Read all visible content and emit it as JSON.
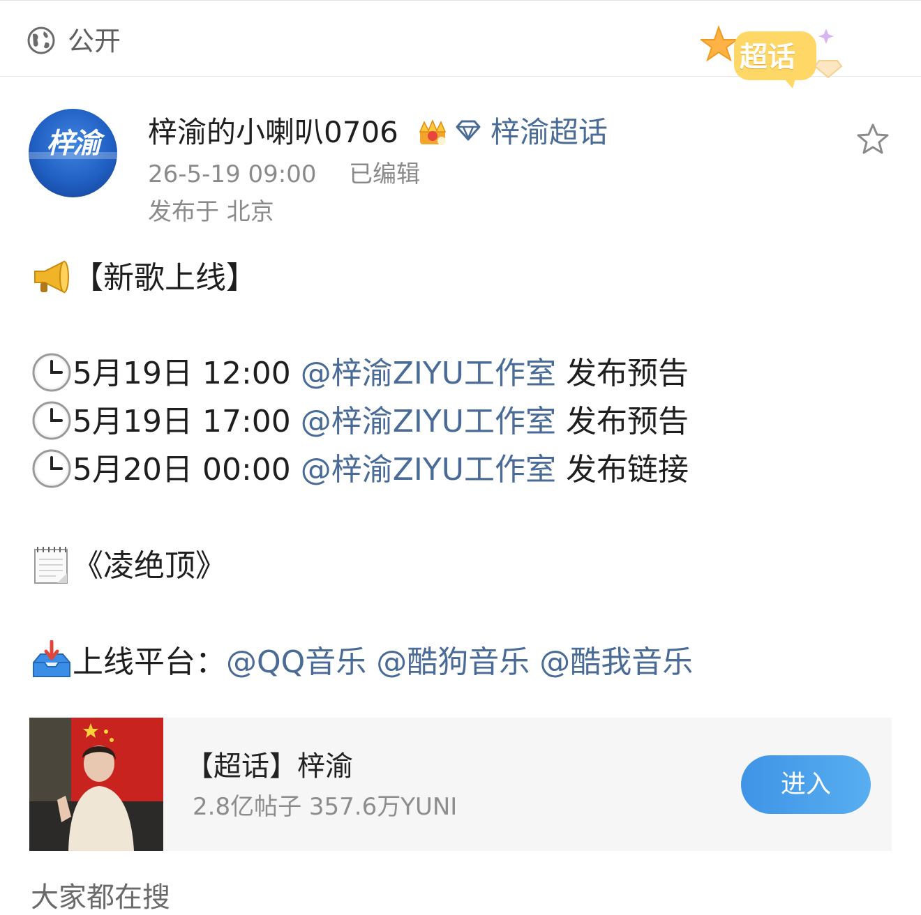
{
  "visibility": {
    "icon": "globe-icon",
    "label": "公开"
  },
  "badge": {
    "icon": "chaohua-badge-icon",
    "label": "超话",
    "color": "#f7c948"
  },
  "post": {
    "avatar_text": "梓渝",
    "username": "梓渝的小喇叭0706",
    "crown_icon": "crown-icon",
    "topic_icon": "diamond-icon",
    "topic_link": "梓渝超话",
    "favorite_icon": "star-icon",
    "time": "26-5-19 09:00",
    "edited": "已编辑",
    "location": "发布于 北京",
    "link_color": "#4a6a97"
  },
  "body": {
    "headline": "【新歌上线】",
    "schedule": [
      {
        "time": "5月19日 12:00 ",
        "mention": "@梓渝ZIYU工作室",
        "action": " 发布预告"
      },
      {
        "time": "5月19日 17:00 ",
        "mention": "@梓渝ZIYU工作室",
        "action": " 发布预告"
      },
      {
        "time": "5月20日 00:00 ",
        "mention": "@梓渝ZIYU工作室",
        "action": "  发布链接"
      }
    ],
    "song": "《凌绝顶》",
    "platform_label": "上线平台：",
    "platforms": [
      "@QQ音乐",
      "@酷狗音乐",
      "@酷我音乐"
    ]
  },
  "card": {
    "title": "【超话】梓渝",
    "stats": "2.8亿帖子 357.6万YUNI",
    "button": "进入",
    "button_color": "#4aa2ec"
  },
  "next_section_partial": "大家都在搜"
}
